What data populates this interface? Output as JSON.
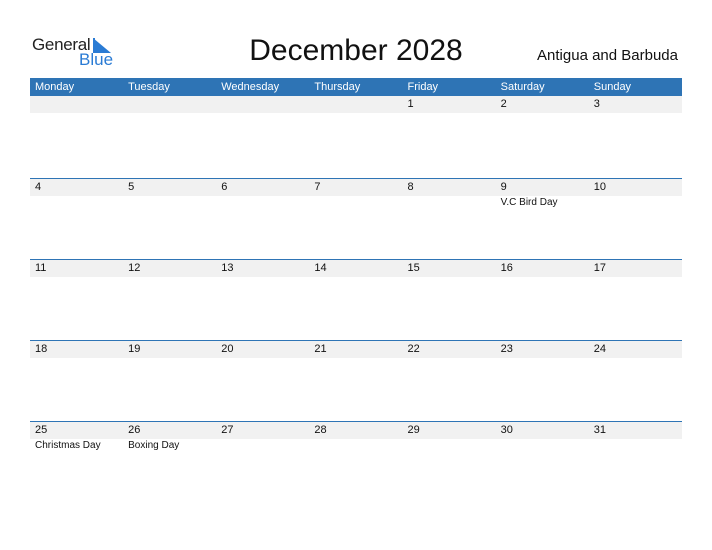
{
  "logo": {
    "line1": "General",
    "line2": "Blue"
  },
  "title": "December 2028",
  "country": "Antigua and Barbuda",
  "colors": {
    "header": "#2e74b5",
    "strip": "#f1f1f1",
    "logo_blue": "#2a7bd4"
  },
  "weekdays": [
    "Monday",
    "Tuesday",
    "Wednesday",
    "Thursday",
    "Friday",
    "Saturday",
    "Sunday"
  ],
  "weeks": [
    {
      "days": [
        "",
        "",
        "",
        "",
        "1",
        "2",
        "3"
      ],
      "events": [
        "",
        "",
        "",
        "",
        "",
        "",
        ""
      ]
    },
    {
      "days": [
        "4",
        "5",
        "6",
        "7",
        "8",
        "9",
        "10"
      ],
      "events": [
        "",
        "",
        "",
        "",
        "",
        "V.C Bird Day",
        ""
      ]
    },
    {
      "days": [
        "11",
        "12",
        "13",
        "14",
        "15",
        "16",
        "17"
      ],
      "events": [
        "",
        "",
        "",
        "",
        "",
        "",
        ""
      ]
    },
    {
      "days": [
        "18",
        "19",
        "20",
        "21",
        "22",
        "23",
        "24"
      ],
      "events": [
        "",
        "",
        "",
        "",
        "",
        "",
        ""
      ]
    },
    {
      "days": [
        "25",
        "26",
        "27",
        "28",
        "29",
        "30",
        "31"
      ],
      "events": [
        "Christmas Day",
        "Boxing Day",
        "",
        "",
        "",
        "",
        ""
      ]
    }
  ]
}
